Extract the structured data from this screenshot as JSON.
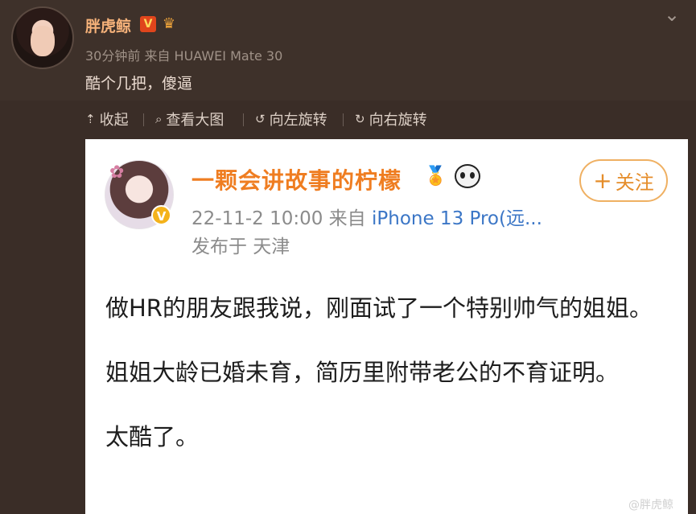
{
  "post": {
    "username": "胖虎鲸",
    "vip_badge": "V",
    "meta": "30分钟前 来自 HUAWEI Mate 30",
    "text": "酷个几把，傻逼"
  },
  "toolbar": [
    {
      "label": "收起",
      "icon": "collapse-icon"
    },
    {
      "label": "查看大图",
      "icon": "zoom-icon"
    },
    {
      "label": "向左旋转",
      "icon": "rotate-left-icon"
    },
    {
      "label": "向右旋转",
      "icon": "rotate-right-icon"
    }
  ],
  "embedded": {
    "username": "一颗会讲故事的柠檬",
    "verified_badge": "V",
    "follow_label": "关注",
    "date": "22-11-2 10:00",
    "from": "来自",
    "device": "iPhone 13 Pro(远...",
    "location": "发布于 天津",
    "paragraphs": [
      "做HR的朋友跟我说，刚面试了一个特别帅气的姐姐。",
      "姐姐大龄已婚未育，简历里附带老公的不育证明。",
      "太酷了。"
    ],
    "watermark": "@胖虎鲸"
  },
  "colors": {
    "dark_bg": "#3a2d27",
    "username": "#f6b27a",
    "embedded_name": "#ef7d21",
    "device_link": "#3b76c6",
    "follow_border": "#efb062"
  }
}
